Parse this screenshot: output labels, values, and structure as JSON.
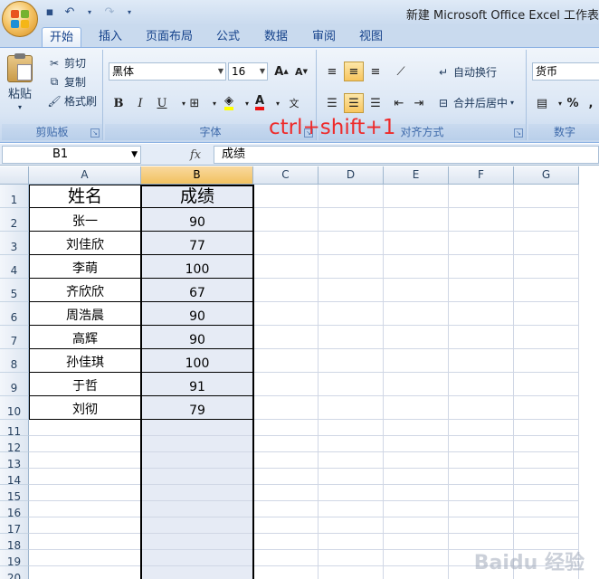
{
  "window": {
    "title": "新建 Microsoft Office Excel 工作表"
  },
  "qat": {
    "save_icon": "save-icon",
    "undo_icon": "undo-icon",
    "redo_icon": "redo-icon"
  },
  "tabs": [
    {
      "label": "开始"
    },
    {
      "label": "插入"
    },
    {
      "label": "页面布局"
    },
    {
      "label": "公式"
    },
    {
      "label": "数据"
    },
    {
      "label": "审阅"
    },
    {
      "label": "视图"
    }
  ],
  "ribbon": {
    "clipboard": {
      "paste": "粘贴",
      "cut": "剪切",
      "copy": "复制",
      "format_painter": "格式刷",
      "label": "剪贴板"
    },
    "font": {
      "name": "黑体",
      "size": "16",
      "grow": "A",
      "shrink": "A",
      "bold": "B",
      "italic": "I",
      "underline": "U",
      "label": "字体"
    },
    "alignment": {
      "wrap": "自动换行",
      "merge": "合并后居中",
      "label": "对齐方式"
    },
    "number": {
      "format": "货币",
      "percent": "%",
      "comma": ",",
      "label": "数字"
    }
  },
  "formula_bar": {
    "name_box": "B1",
    "fx": "fx",
    "content": "成绩"
  },
  "columns": [
    "A",
    "B",
    "C",
    "D",
    "E",
    "F",
    "G"
  ],
  "rows": [
    "1",
    "2",
    "3",
    "4",
    "5",
    "6",
    "7",
    "8",
    "9",
    "10",
    "11",
    "12",
    "13",
    "14",
    "15",
    "16",
    "17",
    "18",
    "19",
    "20"
  ],
  "table": {
    "headers": [
      "姓名",
      "成绩"
    ],
    "data": [
      [
        "张一",
        "90"
      ],
      [
        "刘佳欣",
        "77"
      ],
      [
        "李萌",
        "100"
      ],
      [
        "齐欣欣",
        "67"
      ],
      [
        "周浩晨",
        "90"
      ],
      [
        "高辉",
        "90"
      ],
      [
        "孙佳琪",
        "100"
      ],
      [
        "于哲",
        "91"
      ],
      [
        "刘彻",
        "79"
      ]
    ]
  },
  "annotation": "ctrl+shift+1",
  "watermark": "Baidu 经验"
}
